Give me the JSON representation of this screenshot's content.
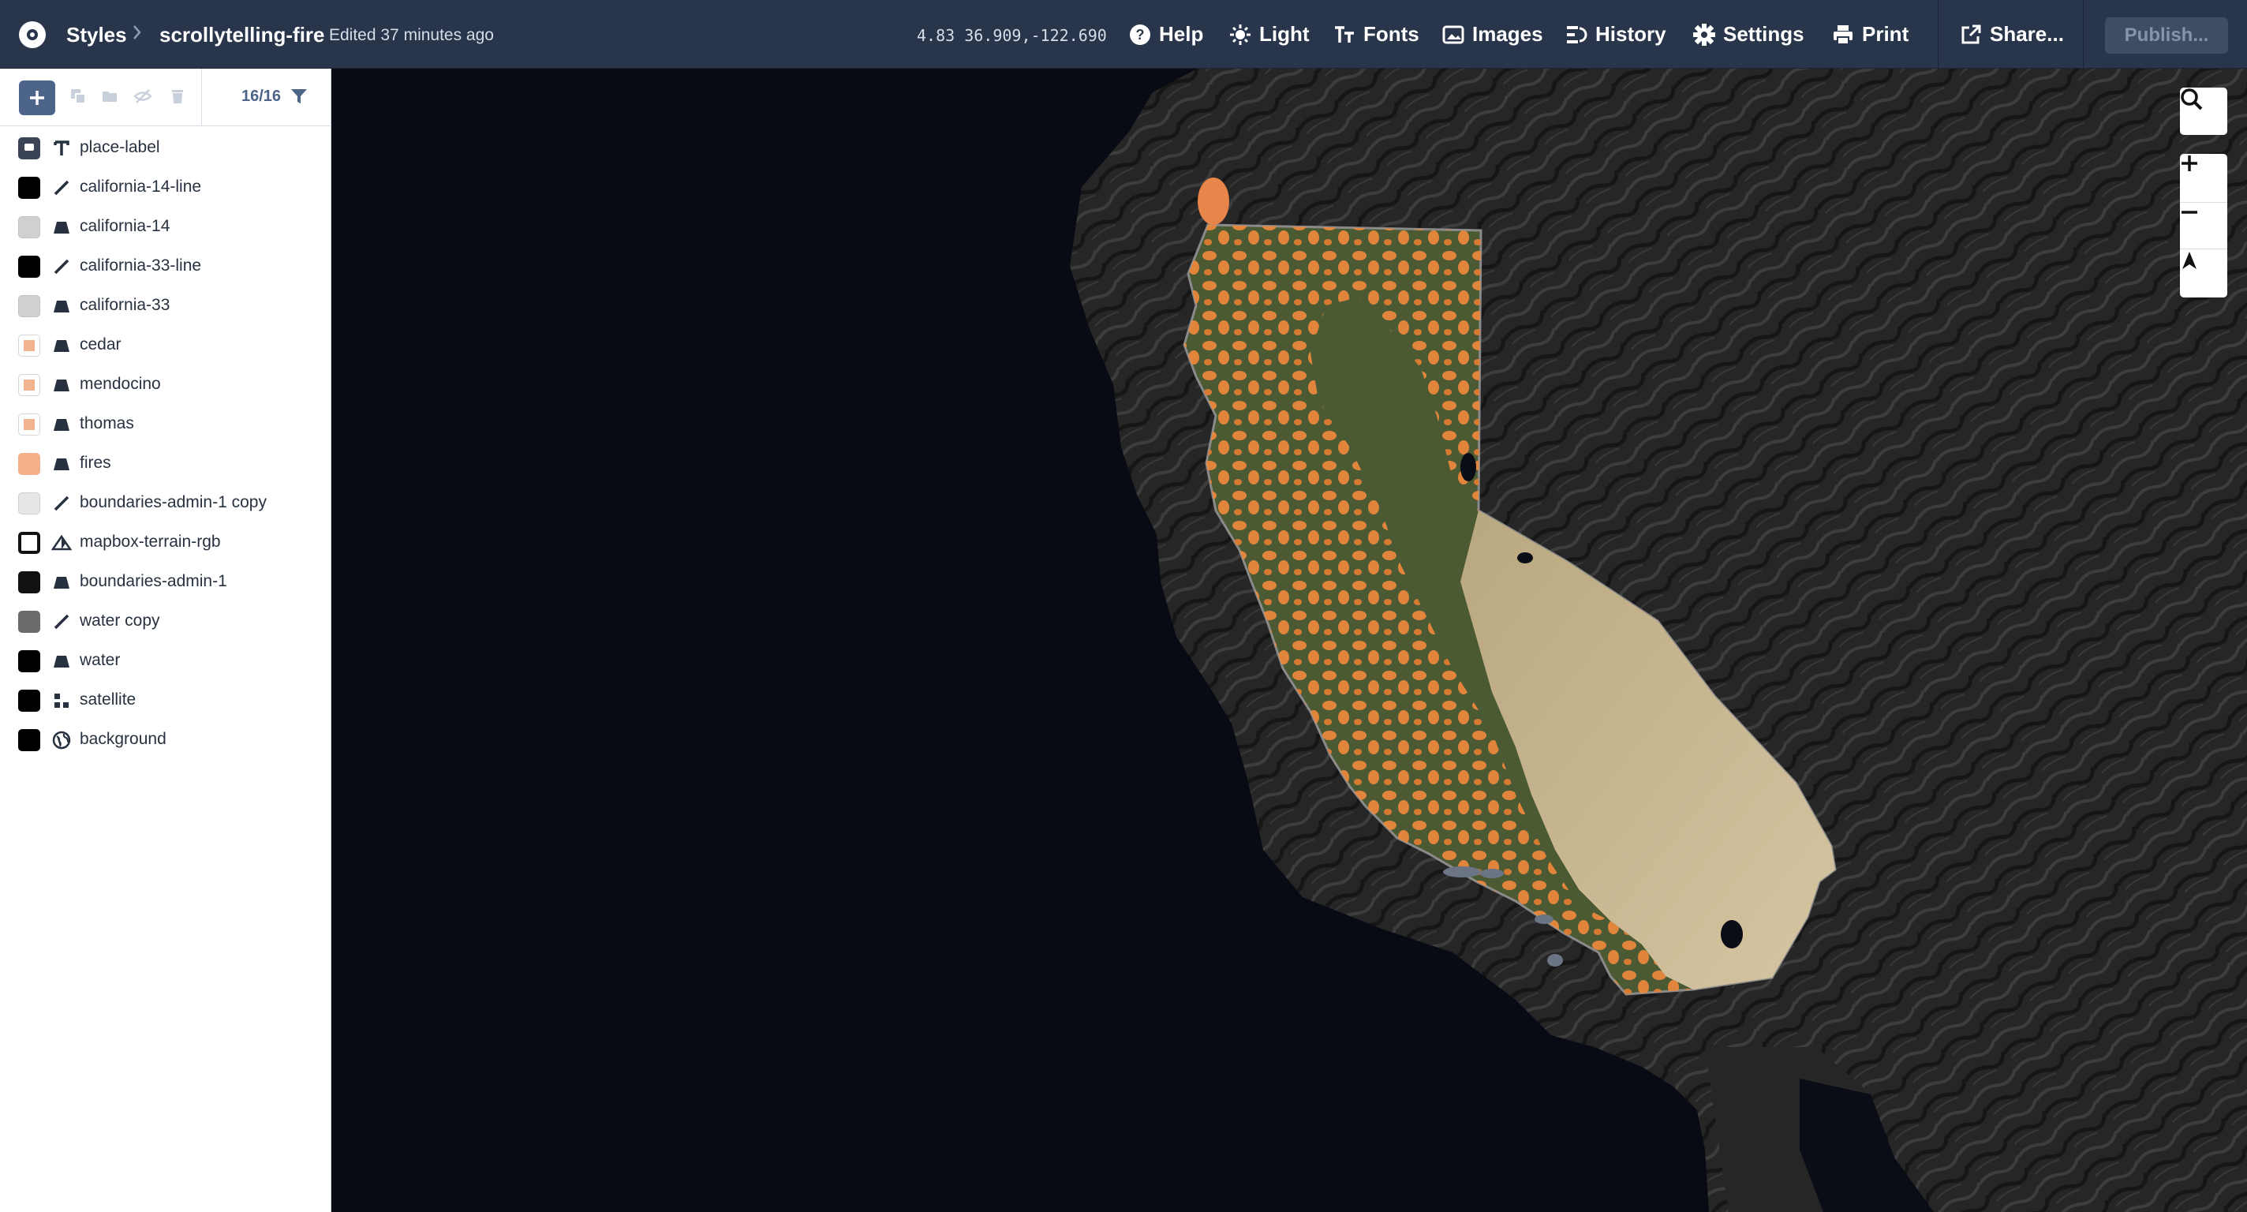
{
  "header": {
    "breadcrumb_root": "Styles",
    "style_name": "scrollytelling-fire",
    "edited": "Edited 37 minutes ago",
    "coordinates": "4.83 36.909,-122.690",
    "nav": [
      {
        "label": "Help",
        "icon": "help-icon"
      },
      {
        "label": "Light",
        "icon": "sun-icon"
      },
      {
        "label": "Fonts",
        "icon": "font-icon"
      },
      {
        "label": "Images",
        "icon": "image-icon"
      },
      {
        "label": "History",
        "icon": "history-icon"
      },
      {
        "label": "Settings",
        "icon": "gear-icon"
      },
      {
        "label": "Print",
        "icon": "printer-icon"
      },
      {
        "label": "Share...",
        "icon": "share-icon"
      }
    ],
    "publish_label": "Publish..."
  },
  "sidebar": {
    "layer_count": "16/16",
    "toolbar_icons": [
      "add-icon",
      "duplicate-icon",
      "folder-icon",
      "hide-icon",
      "trash-icon",
      "filter-icon"
    ],
    "layers": [
      {
        "name": "place-label",
        "type": "symbol",
        "swatch": "#3b4456"
      },
      {
        "name": "california-14-line",
        "type": "line",
        "swatch": "#000000"
      },
      {
        "name": "california-14",
        "type": "fill",
        "swatch": "#d0d0d0"
      },
      {
        "name": "california-33-line",
        "type": "line",
        "swatch": "#000000"
      },
      {
        "name": "california-33",
        "type": "fill",
        "swatch": "#d0d0d0"
      },
      {
        "name": "cedar",
        "type": "fill",
        "swatch": "#f2b38f"
      },
      {
        "name": "mendocino",
        "type": "fill",
        "swatch": "#f2b38f"
      },
      {
        "name": "thomas",
        "type": "fill",
        "swatch": "#f2b38f"
      },
      {
        "name": "fires",
        "type": "fill",
        "swatch": "#f5b08a"
      },
      {
        "name": "boundaries-admin-1 copy",
        "type": "line",
        "swatch": "#e6e6e6"
      },
      {
        "name": "mapbox-terrain-rgb",
        "type": "hillshade",
        "swatch": "#ffffff"
      },
      {
        "name": "boundaries-admin-1",
        "type": "fill",
        "swatch": "#111111"
      },
      {
        "name": "water copy",
        "type": "line",
        "swatch": "#6b6b6b"
      },
      {
        "name": "water",
        "type": "fill",
        "swatch": "#000000"
      },
      {
        "name": "satellite",
        "type": "raster",
        "swatch": "#000000"
      },
      {
        "name": "background",
        "type": "background",
        "swatch": "#000000"
      }
    ]
  },
  "map": {
    "controls": [
      "search-icon",
      "zoom-in-icon",
      "zoom-out-icon",
      "compass-icon"
    ],
    "colors": {
      "ocean": "#080b14",
      "terrain": "#2a2a2a",
      "fire": "#f08a3c",
      "valley": "#4a5a30",
      "desert": "#c9b591"
    }
  }
}
